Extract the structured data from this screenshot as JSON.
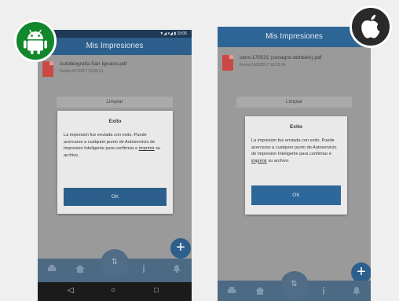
{
  "android": {
    "status_text": "▼◢ ▾◢ ▮ 19:06",
    "app_title": "Mis Impresiones",
    "file": {
      "name": "Autobiografia San Ignacio.pdf",
      "date": "Fecha 4/7/2017 19:06:31"
    },
    "grey_button_label": "Limpiar",
    "dialog": {
      "title": "Exito",
      "message_prefix": "La impresion fue enviada con exito. Puede acercarse a cualquier punto de Autoservicio de Impresion Inteligente para confirmar e ",
      "message_link": "imprimir",
      "message_suffix": " su archivo.",
      "ok_label": "OK"
    },
    "nav_center_glyph": "⇅",
    "fab_label": "+",
    "sys_back": "◁",
    "sys_home": "○",
    "sys_recent": "□"
  },
  "ios": {
    "app_title": "Mis Impresiones",
    "file": {
      "name": "cens-170531 (sonagnn.tambien).pdf",
      "date": "Fecha 14/2/2017 16:15:34"
    },
    "grey_button_label": "Limpiar",
    "dialog": {
      "title": "Exito",
      "message_prefix": "La impresion fue enviada con exito. Puede acercarse a cualquier punto de Autoservicio de Impresion Inteligente para confirmar e ",
      "message_link": "imprimir",
      "message_suffix": " su archivo.",
      "ok_label": "OK"
    },
    "nav_center_glyph": "⇅",
    "fab_label": "+"
  },
  "colors": {
    "brand": "#2c5f8c",
    "android_badge": "#12872c",
    "apple_badge": "#2a2a2a",
    "pdf_red": "#c94a45"
  },
  "icons": [
    "android-logo-icon",
    "apple-logo-icon",
    "pdf-file-icon",
    "add-icon",
    "print-icon",
    "home-icon",
    "bell-icon"
  ]
}
